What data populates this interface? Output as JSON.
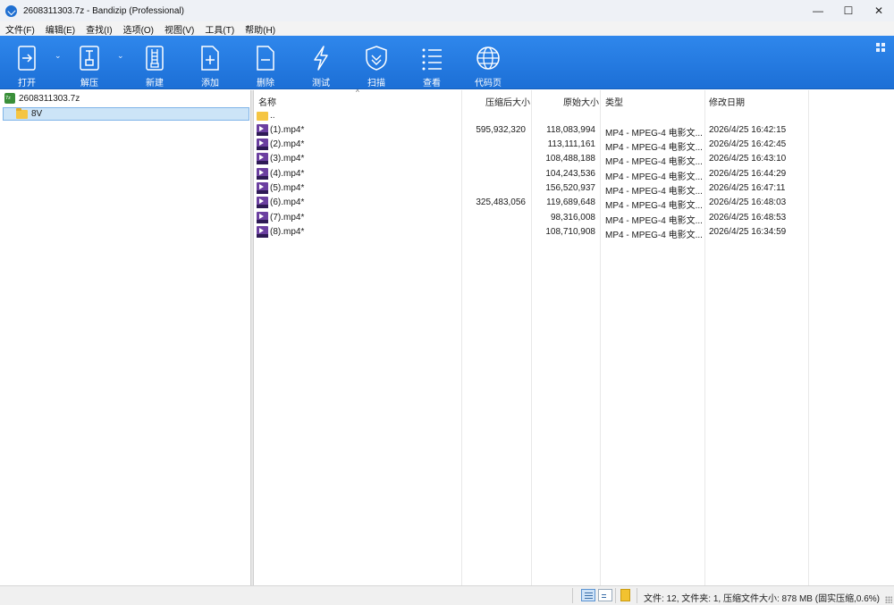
{
  "window": {
    "title": "2608311303.7z - Bandizip (Professional)",
    "minimize": "—",
    "maximize": "☐",
    "close": "✕"
  },
  "menu": [
    "文件(F)",
    "编辑(E)",
    "查找(I)",
    "选项(O)",
    "视图(V)",
    "工具(T)",
    "帮助(H)"
  ],
  "toolbar": {
    "open": "打开",
    "extract": "解压",
    "new": "新建",
    "add": "添加",
    "delete": "删除",
    "test": "测试",
    "scan": "扫描",
    "view": "查看",
    "codepage": "代码页",
    "dropdown_arrow": "⌄"
  },
  "tree": {
    "root": "2608311303.7z",
    "child": "8V"
  },
  "columns": {
    "name": "名称",
    "packed": "压缩后大小",
    "size": "原始大小",
    "type": "类型",
    "modified": "修改日期",
    "sort_indicator": "^"
  },
  "up_entry": "..",
  "files": [
    {
      "name": "(1).mp4*",
      "packed": "595,932,320",
      "size": "118,083,994",
      "type": "MP4 - MPEG-4 电影文...",
      "modified": "2026/4/25 16:42:15"
    },
    {
      "name": "(2).mp4*",
      "packed": "",
      "size": "113,111,161",
      "type": "MP4 - MPEG-4 电影文...",
      "modified": "2026/4/25 16:42:45"
    },
    {
      "name": "(3).mp4*",
      "packed": "",
      "size": "108,488,188",
      "type": "MP4 - MPEG-4 电影文...",
      "modified": "2026/4/25 16:43:10"
    },
    {
      "name": "(4).mp4*",
      "packed": "",
      "size": "104,243,536",
      "type": "MP4 - MPEG-4 电影文...",
      "modified": "2026/4/25 16:44:29"
    },
    {
      "name": "(5).mp4*",
      "packed": "",
      "size": "156,520,937",
      "type": "MP4 - MPEG-4 电影文...",
      "modified": "2026/4/25 16:47:11"
    },
    {
      "name": "(6).mp4*",
      "packed": "325,483,056",
      "size": "119,689,648",
      "type": "MP4 - MPEG-4 电影文...",
      "modified": "2026/4/25 16:48:03"
    },
    {
      "name": "(7).mp4*",
      "packed": "",
      "size": "98,316,008",
      "type": "MP4 - MPEG-4 电影文...",
      "modified": "2026/4/25 16:48:53"
    },
    {
      "name": "(8).mp4*",
      "packed": "",
      "size": "108,710,908",
      "type": "MP4 - MPEG-4 电影文...",
      "modified": "2026/4/25 16:34:59"
    }
  ],
  "status": {
    "text": "文件: 12, 文件夹: 1, 压缩文件大小: 878 MB (固实压缩,0.6%)"
  },
  "colors": {
    "toolbar": "#2f87ec",
    "selection": "#cce4f7",
    "folder": "#f5c542",
    "video_icon": "#6b3fa0"
  }
}
